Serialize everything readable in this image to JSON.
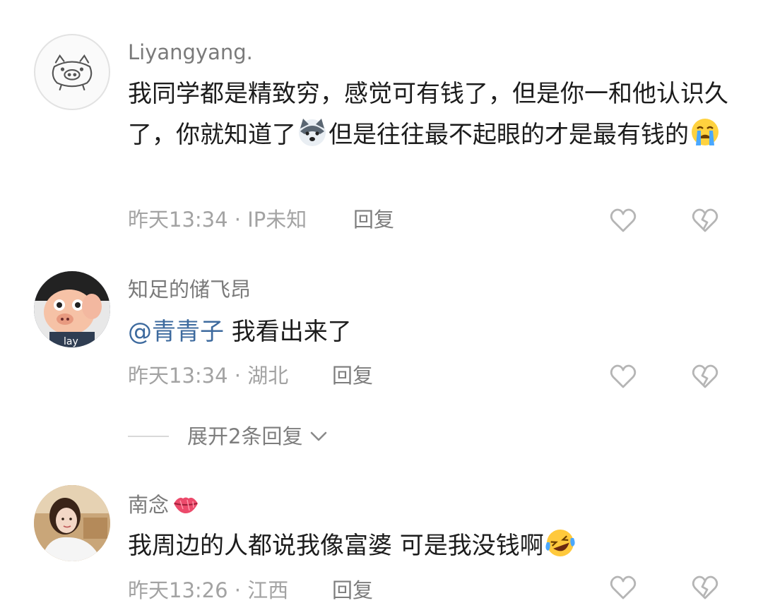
{
  "comments": [
    {
      "username": "Liyangyang.",
      "text_1": "我同学都是精致穷，感觉可有钱了，但是你一和他认识久了，你就知道了",
      "text_2": "但是往往最不起眼的才是最有钱的",
      "time": "昨天13:34 · IP未知",
      "reply_label": "回复",
      "emojis": [
        "husky-emoji",
        "crying-emoji"
      ]
    },
    {
      "username": "知足的储飞昂",
      "mention": "@青青子",
      "text": " 我看出来了",
      "time": "昨天13:34 · 湖北",
      "reply_label": "回复"
    },
    {
      "username": "南念",
      "username_emoji": "lips-emoji",
      "text": "我周边的人都说我像富婆 可是我没钱啊",
      "time": "昨天13:26 · 江西",
      "reply_label": "回复",
      "emojis": [
        "laughing-crying-emoji"
      ]
    }
  ],
  "expand_replies_label": "展开2条回复",
  "colors": {
    "mention": "#3d6a9e",
    "meta": "#a3a3a3",
    "username": "#7a7a7a",
    "icon": "#b5b5b5"
  }
}
